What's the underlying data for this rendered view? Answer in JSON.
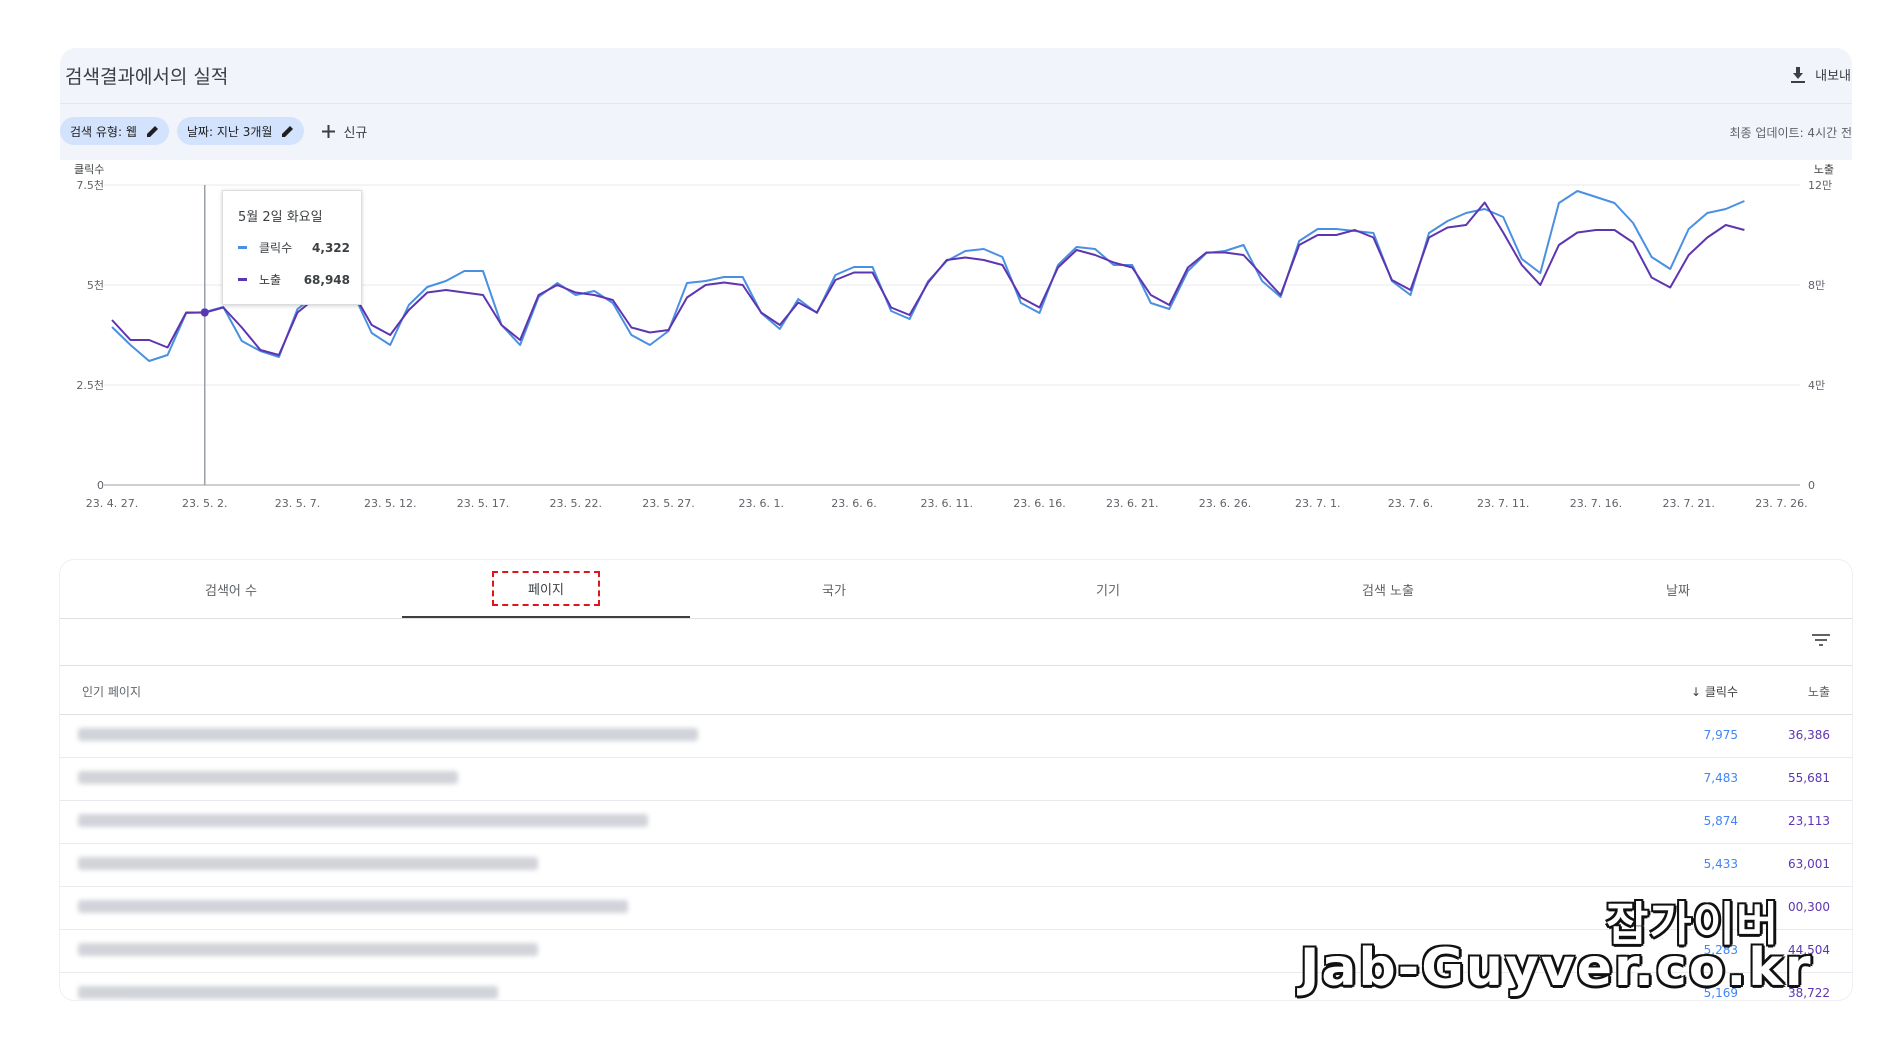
{
  "header": {
    "title": "검색결과에서의 실적",
    "export_label": "내보내"
  },
  "filters": [
    {
      "label": "검색 유형: 웹"
    },
    {
      "label": "날짜: 지난 3개월"
    }
  ],
  "new_filter_label": "신규",
  "last_updated": "최종 업데이트: 4시간 전",
  "colors": {
    "clicks": "#4a90e2",
    "impressions": "#5e35b1",
    "chip": "#d3e3fd",
    "highlight": "#e0151b"
  },
  "chart_data": {
    "type": "line",
    "y_left_label": "클릭수",
    "y_right_label": "노출",
    "y_left_ticks": [
      "0",
      "2.5천",
      "5천",
      "7.5천"
    ],
    "y_right_ticks": [
      "0",
      "4만",
      "8만",
      "12만"
    ],
    "y_left_range": [
      0,
      7500
    ],
    "y_right_range": [
      0,
      120000
    ],
    "x_tick_labels": [
      "23. 4. 27.",
      "23. 5. 2.",
      "23. 5. 7.",
      "23. 5. 12.",
      "23. 5. 17.",
      "23. 5. 22.",
      "23. 5. 27.",
      "23. 6. 1.",
      "23. 6. 6.",
      "23. 6. 11.",
      "23. 6. 16.",
      "23. 6. 21.",
      "23. 6. 26.",
      "23. 7. 1.",
      "23. 7. 6.",
      "23. 7. 11.",
      "23. 7. 16.",
      "23. 7. 21.",
      "23. 7. 26."
    ],
    "x": [
      "23. 4. 27.",
      "23. 4. 28.",
      "23. 4. 29.",
      "23. 4. 30.",
      "23. 5. 1.",
      "23. 5. 2.",
      "23. 5. 3.",
      "23. 5. 4.",
      "23. 5. 5.",
      "23. 5. 6.",
      "23. 5. 7.",
      "23. 5. 8.",
      "23. 5. 9.",
      "23. 5. 10.",
      "23. 5. 11.",
      "23. 5. 12.",
      "23. 5. 13.",
      "23. 5. 14.",
      "23. 5. 15.",
      "23. 5. 16.",
      "23. 5. 17.",
      "23. 5. 18.",
      "23. 5. 19.",
      "23. 5. 20.",
      "23. 5. 21.",
      "23. 5. 22.",
      "23. 5. 23.",
      "23. 5. 24.",
      "23. 5. 25.",
      "23. 5. 26.",
      "23. 5. 27.",
      "23. 5. 28.",
      "23. 5. 29.",
      "23. 5. 30.",
      "23. 5. 31.",
      "23. 6. 1.",
      "23. 6. 2.",
      "23. 6. 3.",
      "23. 6. 4.",
      "23. 6. 5.",
      "23. 6. 6.",
      "23. 6. 7.",
      "23. 6. 8.",
      "23. 6. 9.",
      "23. 6. 10.",
      "23. 6. 11.",
      "23. 6. 12.",
      "23. 6. 13.",
      "23. 6. 14.",
      "23. 6. 15.",
      "23. 6. 16.",
      "23. 6. 17.",
      "23. 6. 18.",
      "23. 6. 19.",
      "23. 6. 20.",
      "23. 6. 21.",
      "23. 6. 22.",
      "23. 6. 23.",
      "23. 6. 24.",
      "23. 6. 25.",
      "23. 6. 26.",
      "23. 6. 27.",
      "23. 6. 28.",
      "23. 6. 29.",
      "23. 6. 30.",
      "23. 7. 1.",
      "23. 7. 2.",
      "23. 7. 3.",
      "23. 7. 4.",
      "23. 7. 5.",
      "23. 7. 6.",
      "23. 7. 7.",
      "23. 7. 8.",
      "23. 7. 9.",
      "23. 7. 10.",
      "23. 7. 11.",
      "23. 7. 12.",
      "23. 7. 13.",
      "23. 7. 14.",
      "23. 7. 15.",
      "23. 7. 16.",
      "23. 7. 17.",
      "23. 7. 18.",
      "23. 7. 19.",
      "23. 7. 20.",
      "23. 7. 21.",
      "23. 7. 22.",
      "23. 7. 23.",
      "23. 7. 24.",
      "23. 7. 25.",
      "23. 7. 26.",
      "23. 7. 27."
    ],
    "series": [
      {
        "name": "클릭수",
        "axis": "left",
        "values": [
          3950,
          3500,
          3100,
          3250,
          4300,
          4322,
          4450,
          3600,
          3350,
          3200,
          4400,
          4750,
          4800,
          4800,
          3800,
          3500,
          4500,
          4950,
          5100,
          5350,
          5350,
          4000,
          3500,
          4700,
          5050,
          4750,
          4850,
          4550,
          3750,
          3500,
          3850,
          5050,
          5100,
          5200,
          5200,
          4300,
          3900,
          4650,
          4300,
          5250,
          5450,
          5450,
          4350,
          4150,
          5100,
          5600,
          5850,
          5900,
          5700,
          4550,
          4300,
          5500,
          5950,
          5900,
          5500,
          5500,
          4550,
          4400,
          5350,
          5800,
          5850,
          6000,
          5100,
          4700,
          6100,
          6400,
          6400,
          6350,
          6300,
          5100,
          4750,
          6300,
          6600,
          6800,
          6900,
          6700,
          5650,
          5300,
          7050,
          7350,
          7200,
          7050,
          6550,
          5700,
          5400,
          6400,
          6800,
          6900,
          7100
        ]
      },
      {
        "name": "노출",
        "axis": "right",
        "values": [
          66000,
          58000,
          58000,
          55000,
          69000,
          68948,
          71000,
          63000,
          54000,
          52000,
          69000,
          75000,
          77000,
          77000,
          64000,
          60000,
          70000,
          77000,
          78000,
          77000,
          76000,
          64000,
          58000,
          76000,
          80000,
          77000,
          76000,
          74000,
          63000,
          61000,
          62000,
          75000,
          80000,
          81000,
          80000,
          69000,
          64000,
          73000,
          69000,
          82000,
          85000,
          85000,
          71000,
          68000,
          81000,
          90000,
          91000,
          90000,
          88000,
          75000,
          71000,
          87000,
          94000,
          92000,
          89000,
          87000,
          76000,
          72000,
          87000,
          93000,
          93000,
          92000,
          84000,
          76000,
          96000,
          100000,
          100000,
          102000,
          99000,
          82000,
          78000,
          99000,
          103000,
          104000,
          113000,
          101000,
          88000,
          80000,
          96000,
          101000,
          102000,
          102000,
          97000,
          83000,
          79000,
          92000,
          99000,
          104000,
          102000
        ]
      }
    ],
    "tooltip": {
      "date": "5월 2일 화요일",
      "clicks_label": "클릭수",
      "clicks_value": "4,322",
      "impr_label": "노출",
      "impr_value": "68,948",
      "index": 5
    },
    "grid": true
  },
  "tabs": [
    {
      "label": "검색어 수"
    },
    {
      "label": "페이지"
    },
    {
      "label": "국가"
    },
    {
      "label": "기기"
    },
    {
      "label": "검색 노출"
    },
    {
      "label": "날짜"
    }
  ],
  "active_tab": "페이지",
  "table": {
    "columns": {
      "page": "인기 페이지",
      "clicks": "클릭수",
      "impressions": "노출"
    },
    "rows": [
      {
        "clicks": "7,975",
        "impressions": "36,386"
      },
      {
        "clicks": "7,483",
        "impressions": "55,681"
      },
      {
        "clicks": "5,874",
        "impressions": "23,113"
      },
      {
        "clicks": "5,433",
        "impressions": "63,001"
      },
      {
        "clicks": "",
        "impressions": "00,300"
      },
      {
        "clicks": "5,283",
        "impressions": "44,504"
      },
      {
        "clicks": "5,169",
        "impressions": "38,722"
      }
    ]
  },
  "watermark": {
    "line1": "잡가이버",
    "line2": "Jab-Guyver.co.kr"
  }
}
